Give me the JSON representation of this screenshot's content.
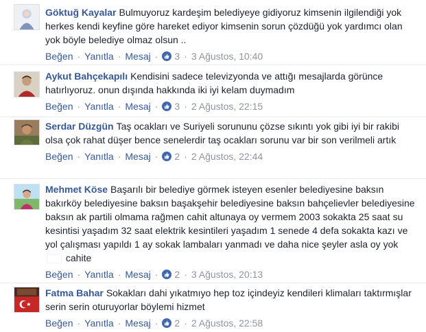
{
  "action_labels": {
    "like": "Beğen",
    "reply": "Yanıtla",
    "message": "Mesaj"
  },
  "separator": "·",
  "like_icon": "thumbs-up-icon",
  "accent": "#365899",
  "like_color": "#4267b2",
  "comments": [
    {
      "author": "Göktuğ Kayalar",
      "text": "Bulmuyoruz kardeşim belediyeye gidiyoruz kimsenin ilgilendiği yok herkes kendi keyfine göre hareket ediyor kimsenin sorun çözdüğü yok yardımcı olan yok böyle belediye olmaz olsun ..",
      "likes": "3",
      "date": "3 Ağustos, 10:40"
    },
    {
      "author": "Aykut Bahçekapılı",
      "text": "Kendisini sadece televizyonda ve attığı mesajlarda görünce hatırlıyoruz. onun dışında hakkında iki iyi kelam duymadım",
      "likes": "3",
      "date": "2 Ağustos, 22:15"
    },
    {
      "author": "Serdar Düzgün",
      "text": "Taş ocakları ve Suriyeli sorununu çözse sıkıntı yok gibi iyi bir rakibi olsa çok rahat düşer bence senelerdir taş ocakları sorunu var bir son verilmeli artık",
      "likes": "2",
      "date": "2 Ağustos, 22:44"
    },
    {
      "author": "Mehmet Köse",
      "text": "Başarılı bir belediye görmek isteyen esenler belediyesine baksın bakırköy belediyesine baksın başakşehir belediyesine baksın bahçelievler belediyesine baksın ak partili olmama rağmen cahit altunaya oy vermem 2003 sokakta 25 saat su kesintisi yaşadım 32 saat elektrik kesintileri yaşadım 1 senede 4 defa sokakta kazı ve yol çalışması yapıldı 1 ay sokak lambaları yanmadı ve daha nice şeyler asla oy yok",
      "text_tail": "cahite",
      "likes": "2",
      "date": "3 Ağustos, 20:13"
    },
    {
      "author": "Fatma Bahar",
      "text": "Sokakları dahi yıkatmıyo hep toz içindeyiz kendileri klimaları taktırmışlar serin serin oturuyorlar böylemi hizmet",
      "likes": "2",
      "date": "2 Ağustos, 22:58"
    }
  ]
}
